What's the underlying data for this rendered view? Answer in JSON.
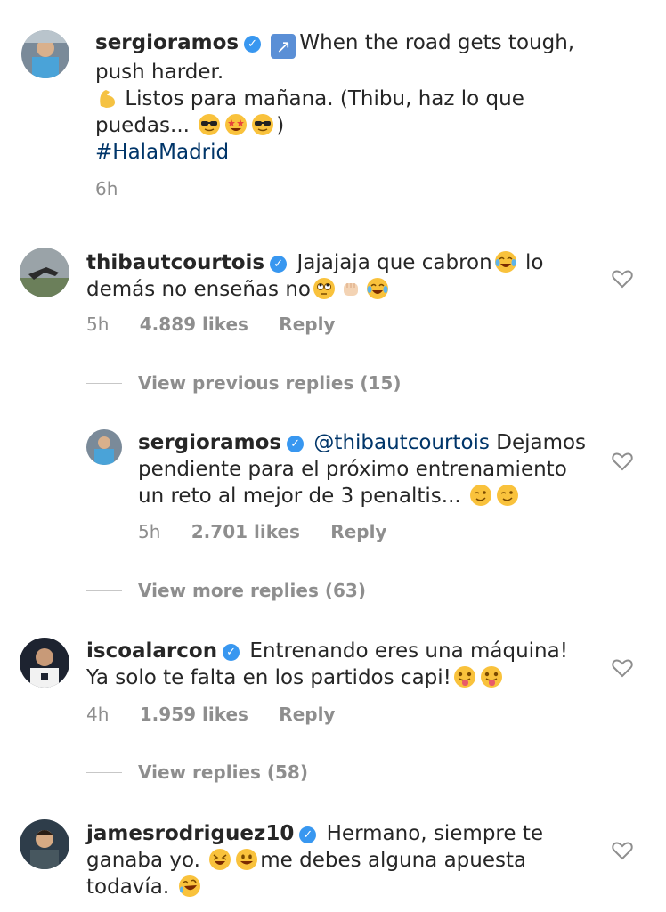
{
  "caption": {
    "username": "sergioramos",
    "line1": "When the road gets tough,",
    "line2": "push harder.",
    "line3": "Listos para mañana. (Thibu, haz lo que",
    "line4_prefix": "puedas...",
    "line4_suffix": ")",
    "hashtag": "#HalaMadrid",
    "time": "6h"
  },
  "comments": [
    {
      "username": "thibautcourtois",
      "text1": "Jajajaja que cabron",
      "text1_suffix": "lo",
      "text2": "demás no enseñas no",
      "time": "5h",
      "likes": "4.889 likes",
      "reply": "Reply",
      "view_replies": "View previous replies (15)"
    },
    {
      "username": "sergioramos",
      "mention": "@thibautcourtois",
      "text1": "Dejamos",
      "text2": "pendiente para el próximo entrenamiento",
      "text3": "un reto al mejor de 3 penaltis...",
      "time": "5h",
      "likes": "2.701 likes",
      "reply": "Reply",
      "view_replies": "View more replies (63)"
    },
    {
      "username": "iscoalarcon",
      "text1": "Entrenando eres una máquina!",
      "text2": "Ya solo te falta en los partidos capi!",
      "time": "4h",
      "likes": "1.959 likes",
      "reply": "Reply",
      "view_replies": "View replies (58)"
    },
    {
      "username": "jamesrodriguez10",
      "text1": "Hermano, siempre te",
      "text2_prefix": "ganaba yo.",
      "text2_suffix": "me debes alguna apuesta",
      "text3": "todavía."
    }
  ],
  "icons": {
    "verified": "verified-badge-icon",
    "heart": "heart-outline-icon"
  },
  "colors": {
    "verified": "#3897f0",
    "hashtag": "#003569",
    "meta": "#8e8e8e"
  }
}
